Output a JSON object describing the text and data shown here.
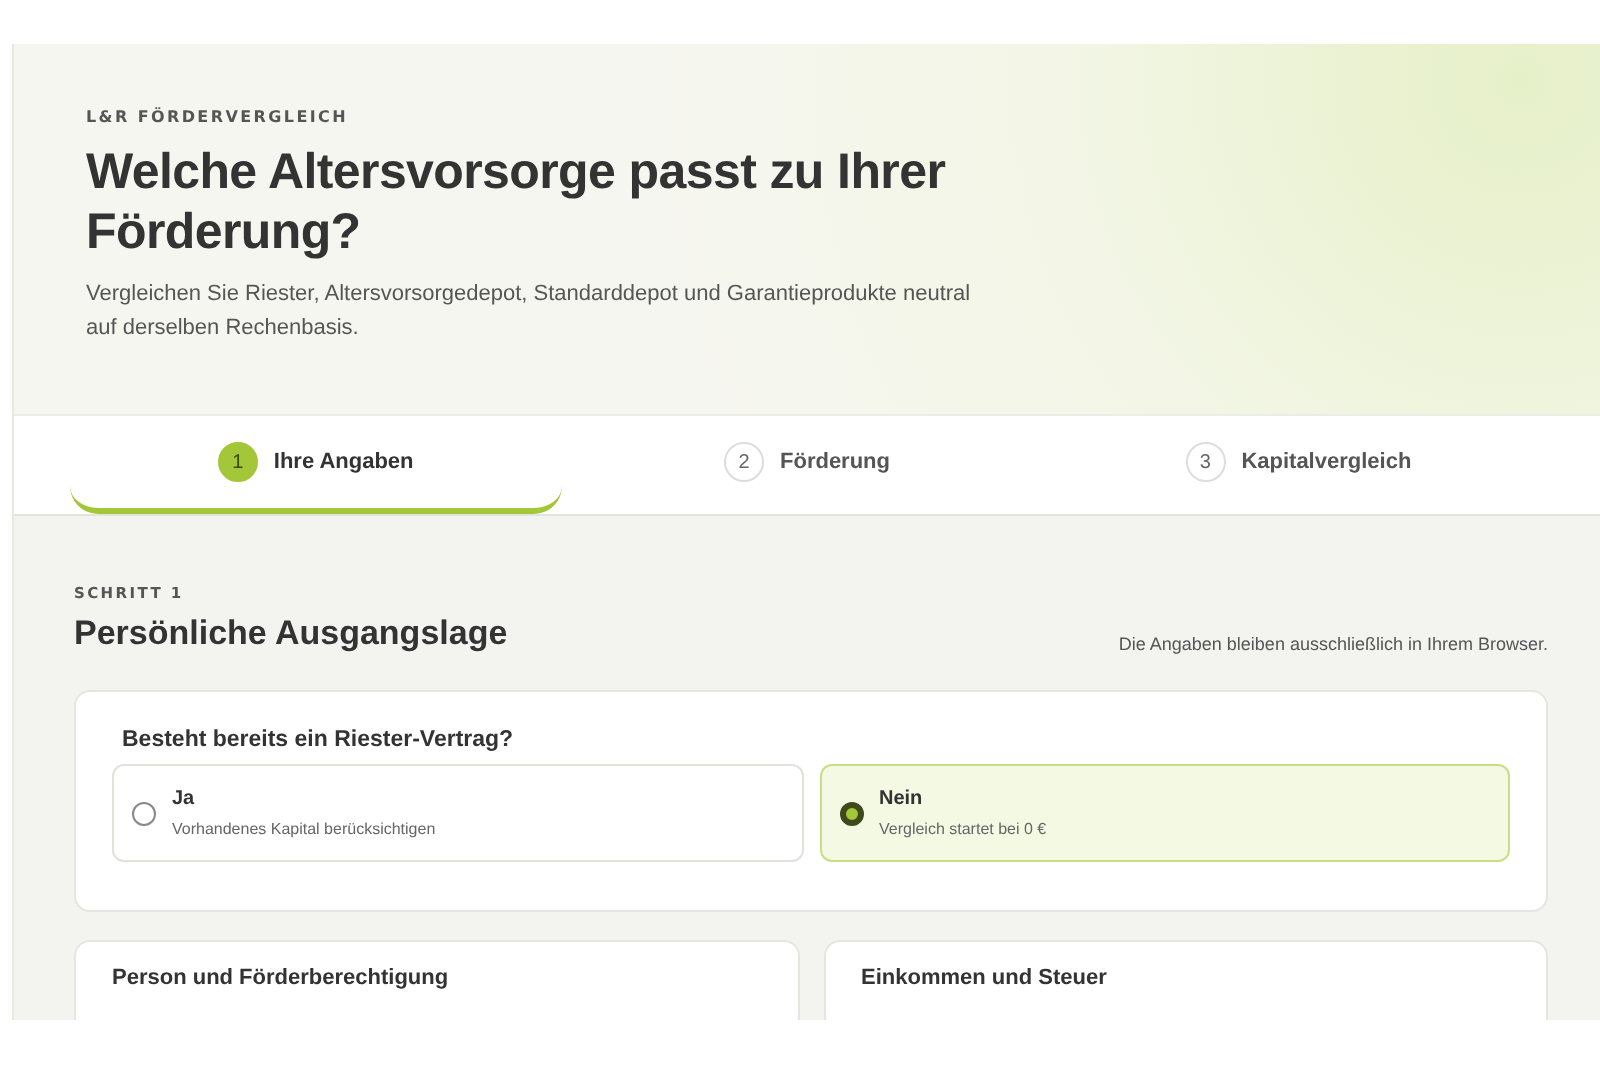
{
  "header": {
    "eyebrow": "L&R FÖRDERVERGLEICH",
    "title": "Welche Altersvorsorge passt zu Ihrer Förderung?",
    "subtitle": "Vergleichen Sie Riester, Altersvorsorgedepot, Standarddepot und Garantieprodukte neutral auf derselben Rechenbasis."
  },
  "steps": [
    {
      "number": "1",
      "label": "Ihre Angaben",
      "selected": true
    },
    {
      "number": "2",
      "label": "Förderung",
      "selected": false
    },
    {
      "number": "3",
      "label": "Kapitalvergleich",
      "selected": false
    }
  ],
  "section": {
    "eyebrow": "SCHRITT 1",
    "title": "Persönliche Ausgangslage",
    "note": "Die Angaben bleiben ausschließlich in Ihrem Browser."
  },
  "question": {
    "label": "Besteht bereits ein Riester-Vertrag?",
    "options": [
      {
        "title": "Ja",
        "hint": "Vorhandenes Kapital berücksichtigen",
        "selected": false
      },
      {
        "title": "Nein",
        "hint": "Vergleich startet bei 0 €",
        "selected": true
      }
    ]
  },
  "cards": [
    {
      "title": "Person und Förderberechtigung"
    },
    {
      "title": "Einkommen und Steuer"
    }
  ]
}
